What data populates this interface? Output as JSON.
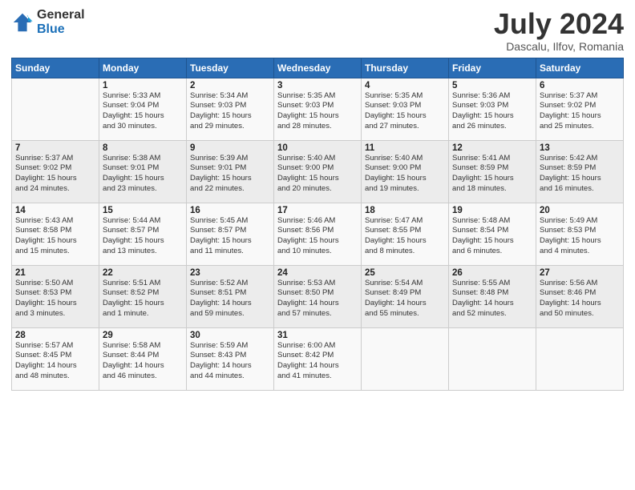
{
  "header": {
    "logo_general": "General",
    "logo_blue": "Blue",
    "month_year": "July 2024",
    "location": "Dascalu, Ilfov, Romania"
  },
  "weekdays": [
    "Sunday",
    "Monday",
    "Tuesday",
    "Wednesday",
    "Thursday",
    "Friday",
    "Saturday"
  ],
  "weeks": [
    [
      {
        "day": "",
        "info": ""
      },
      {
        "day": "1",
        "info": "Sunrise: 5:33 AM\nSunset: 9:04 PM\nDaylight: 15 hours\nand 30 minutes."
      },
      {
        "day": "2",
        "info": "Sunrise: 5:34 AM\nSunset: 9:03 PM\nDaylight: 15 hours\nand 29 minutes."
      },
      {
        "day": "3",
        "info": "Sunrise: 5:35 AM\nSunset: 9:03 PM\nDaylight: 15 hours\nand 28 minutes."
      },
      {
        "day": "4",
        "info": "Sunrise: 5:35 AM\nSunset: 9:03 PM\nDaylight: 15 hours\nand 27 minutes."
      },
      {
        "day": "5",
        "info": "Sunrise: 5:36 AM\nSunset: 9:03 PM\nDaylight: 15 hours\nand 26 minutes."
      },
      {
        "day": "6",
        "info": "Sunrise: 5:37 AM\nSunset: 9:02 PM\nDaylight: 15 hours\nand 25 minutes."
      }
    ],
    [
      {
        "day": "7",
        "info": "Sunrise: 5:37 AM\nSunset: 9:02 PM\nDaylight: 15 hours\nand 24 minutes."
      },
      {
        "day": "8",
        "info": "Sunrise: 5:38 AM\nSunset: 9:01 PM\nDaylight: 15 hours\nand 23 minutes."
      },
      {
        "day": "9",
        "info": "Sunrise: 5:39 AM\nSunset: 9:01 PM\nDaylight: 15 hours\nand 22 minutes."
      },
      {
        "day": "10",
        "info": "Sunrise: 5:40 AM\nSunset: 9:00 PM\nDaylight: 15 hours\nand 20 minutes."
      },
      {
        "day": "11",
        "info": "Sunrise: 5:40 AM\nSunset: 9:00 PM\nDaylight: 15 hours\nand 19 minutes."
      },
      {
        "day": "12",
        "info": "Sunrise: 5:41 AM\nSunset: 8:59 PM\nDaylight: 15 hours\nand 18 minutes."
      },
      {
        "day": "13",
        "info": "Sunrise: 5:42 AM\nSunset: 8:59 PM\nDaylight: 15 hours\nand 16 minutes."
      }
    ],
    [
      {
        "day": "14",
        "info": "Sunrise: 5:43 AM\nSunset: 8:58 PM\nDaylight: 15 hours\nand 15 minutes."
      },
      {
        "day": "15",
        "info": "Sunrise: 5:44 AM\nSunset: 8:57 PM\nDaylight: 15 hours\nand 13 minutes."
      },
      {
        "day": "16",
        "info": "Sunrise: 5:45 AM\nSunset: 8:57 PM\nDaylight: 15 hours\nand 11 minutes."
      },
      {
        "day": "17",
        "info": "Sunrise: 5:46 AM\nSunset: 8:56 PM\nDaylight: 15 hours\nand 10 minutes."
      },
      {
        "day": "18",
        "info": "Sunrise: 5:47 AM\nSunset: 8:55 PM\nDaylight: 15 hours\nand 8 minutes."
      },
      {
        "day": "19",
        "info": "Sunrise: 5:48 AM\nSunset: 8:54 PM\nDaylight: 15 hours\nand 6 minutes."
      },
      {
        "day": "20",
        "info": "Sunrise: 5:49 AM\nSunset: 8:53 PM\nDaylight: 15 hours\nand 4 minutes."
      }
    ],
    [
      {
        "day": "21",
        "info": "Sunrise: 5:50 AM\nSunset: 8:53 PM\nDaylight: 15 hours\nand 3 minutes."
      },
      {
        "day": "22",
        "info": "Sunrise: 5:51 AM\nSunset: 8:52 PM\nDaylight: 15 hours\nand 1 minute."
      },
      {
        "day": "23",
        "info": "Sunrise: 5:52 AM\nSunset: 8:51 PM\nDaylight: 14 hours\nand 59 minutes."
      },
      {
        "day": "24",
        "info": "Sunrise: 5:53 AM\nSunset: 8:50 PM\nDaylight: 14 hours\nand 57 minutes."
      },
      {
        "day": "25",
        "info": "Sunrise: 5:54 AM\nSunset: 8:49 PM\nDaylight: 14 hours\nand 55 minutes."
      },
      {
        "day": "26",
        "info": "Sunrise: 5:55 AM\nSunset: 8:48 PM\nDaylight: 14 hours\nand 52 minutes."
      },
      {
        "day": "27",
        "info": "Sunrise: 5:56 AM\nSunset: 8:46 PM\nDaylight: 14 hours\nand 50 minutes."
      }
    ],
    [
      {
        "day": "28",
        "info": "Sunrise: 5:57 AM\nSunset: 8:45 PM\nDaylight: 14 hours\nand 48 minutes."
      },
      {
        "day": "29",
        "info": "Sunrise: 5:58 AM\nSunset: 8:44 PM\nDaylight: 14 hours\nand 46 minutes."
      },
      {
        "day": "30",
        "info": "Sunrise: 5:59 AM\nSunset: 8:43 PM\nDaylight: 14 hours\nand 44 minutes."
      },
      {
        "day": "31",
        "info": "Sunrise: 6:00 AM\nSunset: 8:42 PM\nDaylight: 14 hours\nand 41 minutes."
      },
      {
        "day": "",
        "info": ""
      },
      {
        "day": "",
        "info": ""
      },
      {
        "day": "",
        "info": ""
      }
    ]
  ]
}
